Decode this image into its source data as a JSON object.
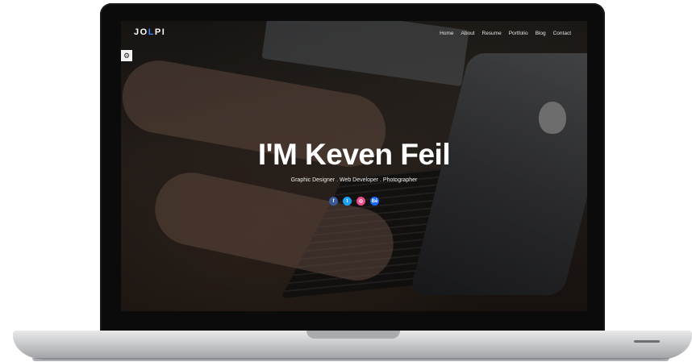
{
  "header": {
    "logo_prefix": "JO",
    "logo_accent": "L",
    "logo_suffix": "PI",
    "nav": [
      "Home",
      "About",
      "Resume",
      "Portfolio",
      "Blog",
      "Contact"
    ]
  },
  "hero": {
    "title": "I'M Keven Feil",
    "subtitle": "Graphic Designer . Web Developer . Photographer"
  },
  "socials": [
    {
      "icon": "facebook-icon",
      "glyph": "f",
      "color": "#3b5998"
    },
    {
      "icon": "twitter-icon",
      "glyph": "t",
      "color": "#1da1f2"
    },
    {
      "icon": "dribbble-icon",
      "glyph": "◎",
      "color": "#ea4c89"
    },
    {
      "icon": "behance-icon",
      "glyph": "Bē",
      "color": "#1769ff"
    }
  ],
  "side_tool": {
    "icon": "settings-icon",
    "glyph": "⚙"
  },
  "colors": {
    "accent": "#3b82f6"
  }
}
